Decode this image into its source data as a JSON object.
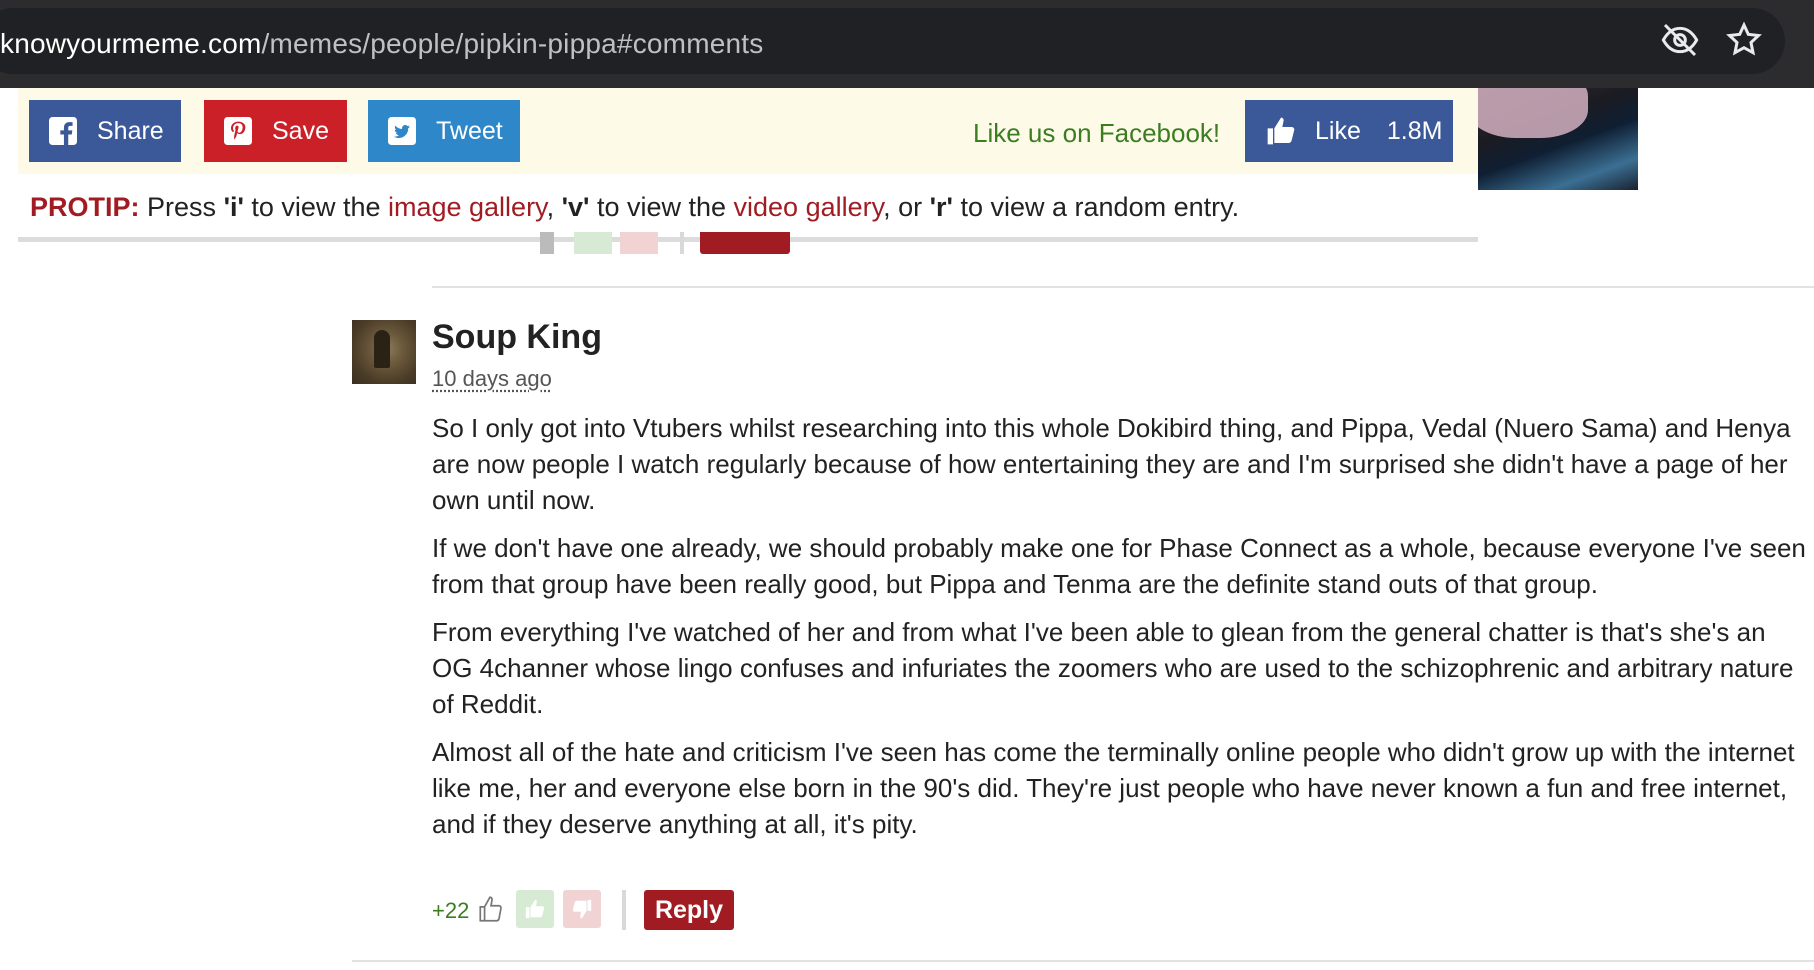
{
  "browser": {
    "url_host": "knowyourmeme.com",
    "url_path": "/memes/people/pipkin-pippa#comments"
  },
  "sharebar": {
    "share_label": "Share",
    "save_label": "Save",
    "tweet_label": "Tweet",
    "like_us": "Like us on Facebook!",
    "like_label": "Like",
    "like_count": "1.8M"
  },
  "protip": {
    "prefix": "PROTIP:",
    "t1": "Press ",
    "k1": "'i'",
    "t2": " to view the ",
    "l1": "image gallery",
    "t3": ", ",
    "k2": "'v'",
    "t4": " to view the ",
    "l2": "video gallery",
    "t5": ", or ",
    "k3": "'r'",
    "t6": " to view a random entry."
  },
  "comment": {
    "username": "Soup King",
    "time": "10 days ago",
    "paragraphs": [
      "So I only got into Vtubers whilst researching into this whole Dokibird thing, and Pippa, Vedal (Nuero Sama) and Henya are now people I watch regularly because of how entertaining they are and I'm surprised she didn't have a page of her own until now.",
      "If we don't have one already, we should probably make one for Phase Connect as a whole, because everyone I've seen from that group have been really good, but Pippa and Tenma are the definite stand outs of that group.",
      "From everything I've watched of her and from what I've been able to glean from the general chatter is that's she's an OG 4channer whose lingo confuses and infuriates the zoomers who are used to the schizophrenic and arbitrary nature of Reddit.",
      "Almost all of the hate and criticism I've seen has come the terminally online people who didn't grow up with the internet like me, her and everyone else born in the 90's did. They're just people who have never known a fun and free internet, and if they deserve anything at all, it's pity."
    ],
    "score": "+22",
    "reply_label": "Reply"
  }
}
